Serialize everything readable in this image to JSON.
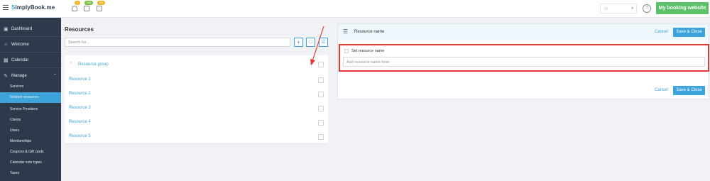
{
  "topbar": {
    "logo_prefix": "S",
    "logo_main": "implyBook",
    "logo_suffix": ".me",
    "badges": [
      "1",
      "100",
      "89"
    ],
    "booking_button": "My booking website",
    "help_label": "?"
  },
  "sidebar": {
    "items": [
      {
        "label": "Dashboard",
        "icon": "dashboard-icon"
      },
      {
        "label": "Welcome",
        "icon": "lightbulb-icon"
      },
      {
        "label": "Calendar",
        "icon": "calendar-icon"
      },
      {
        "label": "Manage",
        "icon": "pencil-icon"
      }
    ],
    "sub_items": [
      "Services",
      "Related resources",
      "Service Providers",
      "Clients",
      "Users",
      "Memberships",
      "Coupons & Gift cards",
      "Calendar note types",
      "Taxes"
    ],
    "active_sub": "Related resources"
  },
  "resources": {
    "title": "Resources",
    "search_placeholder": "Search for...",
    "group_label": "Resource group",
    "items": [
      "Resource 1",
      "Resource 2",
      "Resource 3",
      "Resource 4",
      "Resource 5"
    ]
  },
  "editor": {
    "title": "Resource name",
    "cancel": "Cancel",
    "save": "Save & Close",
    "set_label": "Set resource name",
    "input_placeholder": "Add resource name here"
  },
  "colors": {
    "accent": "#3ca3db",
    "booking_green": "#5cc16a",
    "sidebar_bg": "#2d3a4b",
    "highlight_red": "#e53935"
  }
}
